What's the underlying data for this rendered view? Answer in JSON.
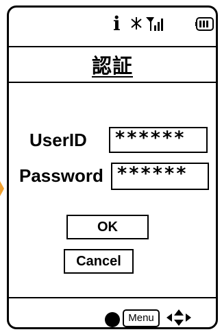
{
  "status_bar": {
    "info_glyph": "i",
    "icons": [
      "info-icon",
      "bluetooth-icon",
      "signal-icon",
      "battery-icon"
    ]
  },
  "header": {
    "title": "認証"
  },
  "form": {
    "userid": {
      "label": "UserID",
      "value": "******"
    },
    "password": {
      "label": "Password",
      "value": "******"
    }
  },
  "buttons": {
    "ok_label": "OK",
    "cancel_label": "Cancel"
  },
  "softkeys": {
    "menu_label": "Menu",
    "icons": [
      "center-dot-icon",
      "dpad-icon"
    ]
  },
  "colors": {
    "foreground": "#000000",
    "background": "#ffffff",
    "edge_accent": "#f0a030"
  }
}
